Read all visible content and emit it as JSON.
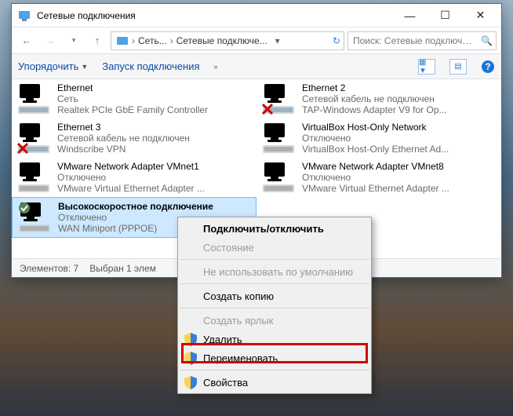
{
  "window": {
    "title": "Сетевые подключения"
  },
  "nav": {
    "crumb1": "Сеть...",
    "crumb2": "Сетевые подключе...",
    "search_placeholder": "Поиск: Сетевые подключен..."
  },
  "toolbar": {
    "organize": "Упорядочить",
    "start_conn": "Запуск подключения"
  },
  "adapters": [
    {
      "name": "Ethernet",
      "status": "Сеть",
      "device": "Realtek PCIe GbE Family Controller",
      "state": "ok"
    },
    {
      "name": "Ethernet 3",
      "status": "Сетевой кабель не подключен",
      "device": "Windscribe VPN",
      "state": "unplugged"
    },
    {
      "name": "VMware Network Adapter VMnet1",
      "status": "Отключено",
      "device": "VMware Virtual Ethernet Adapter ...",
      "state": "disabled"
    },
    {
      "name": "Высокоскоростное подключение",
      "status": "Отключено",
      "device": "WAN Miniport (PPPOE)",
      "state": "ok",
      "selected": true
    },
    {
      "name": "Ethernet 2",
      "status": "Сетевой кабель не подключен",
      "device": "TAP-Windows Adapter V9 for Op...",
      "state": "unplugged"
    },
    {
      "name": "VirtualBox Host-Only Network",
      "status": "Отключено",
      "device": "VirtualBox Host-Only Ethernet Ad...",
      "state": "disabled"
    },
    {
      "name": "VMware Network Adapter VMnet8",
      "status": "Отключено",
      "device": "VMware Virtual Ethernet Adapter ...",
      "state": "disabled"
    }
  ],
  "status": {
    "count": "Элементов: 7",
    "selected": "Выбран 1 элем"
  },
  "context_menu": {
    "connect": "Подключить/отключить",
    "status": "Состояние",
    "nodefault": "Не использовать по умолчанию",
    "copy": "Создать копию",
    "shortcut": "Создать ярлык",
    "delete": "Удалить",
    "rename": "Переименовать",
    "properties": "Свойства"
  }
}
